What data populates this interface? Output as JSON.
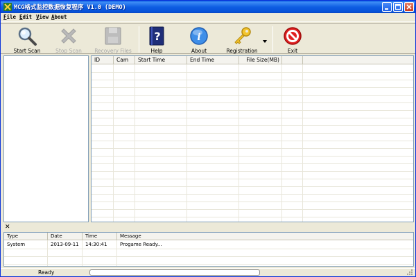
{
  "window": {
    "title": "MCG格式监控数据恢复程序 V1.0 (DEMO)"
  },
  "menu": [
    {
      "label": "File"
    },
    {
      "label": "Edit"
    },
    {
      "label": "View"
    },
    {
      "label": "About"
    }
  ],
  "toolbar": {
    "start_scan": {
      "label": "Start Scan",
      "icon": "magnifier-icon"
    },
    "stop_scan": {
      "label": "Stop Scan",
      "icon": "x-mark-icon",
      "disabled": true
    },
    "recovery_files": {
      "label": "Recovery Files",
      "icon": "save-disk-icon",
      "disabled": true
    },
    "help": {
      "label": "Help",
      "icon": "help-book-icon"
    },
    "about": {
      "label": "About",
      "icon": "info-icon"
    },
    "registration": {
      "label": "Registration",
      "icon": "key-icon"
    },
    "exit": {
      "label": "Exit",
      "icon": "no-entry-icon"
    }
  },
  "file_grid": {
    "columns": [
      "ID",
      "Cam",
      "Start Time",
      "End Time",
      "File Size(MB)"
    ],
    "rows": []
  },
  "log": {
    "columns": [
      "Type",
      "Date",
      "Time",
      "Message"
    ],
    "rows": [
      {
        "type": "System",
        "date": "2013-09-11",
        "time": "14:30:41",
        "message": "Progame Ready..."
      }
    ]
  },
  "status": {
    "text": "Ready",
    "progress": 0
  },
  "colors": {
    "titlebar": "#0a5ce0",
    "chrome": "#ece9d8",
    "pane_border": "#7f9db9"
  }
}
